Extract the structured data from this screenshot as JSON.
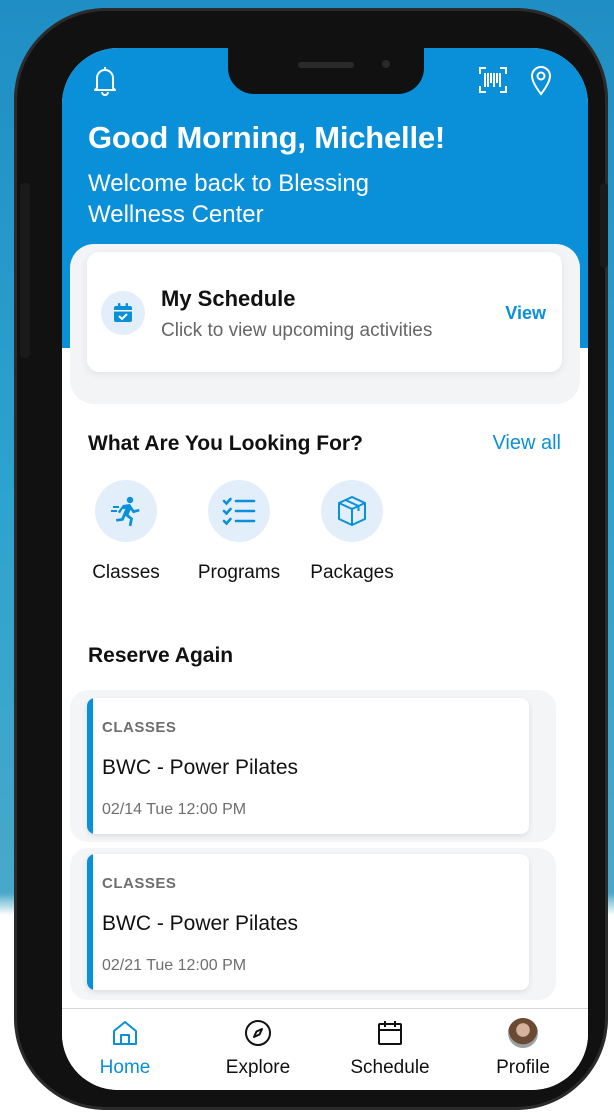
{
  "header": {
    "greeting": "Good Morning, Michelle!",
    "subtitle": "Welcome back to Blessing Wellness Center",
    "icons": [
      "bell-icon",
      "barcode-scan-icon",
      "location-pin-icon"
    ]
  },
  "schedule_card": {
    "title": "My Schedule",
    "subtitle": "Click to view upcoming activities",
    "action": "View",
    "icon": "calendar-check-icon"
  },
  "looking_for": {
    "title": "What Are You Looking For?",
    "view_all": "View all",
    "categories": [
      {
        "label": "Classes",
        "icon": "running-person-icon"
      },
      {
        "label": "Programs",
        "icon": "checklist-icon"
      },
      {
        "label": "Packages",
        "icon": "package-box-icon"
      }
    ]
  },
  "reserve_again": {
    "title": "Reserve Again",
    "items": [
      {
        "tag": "CLASSES",
        "name": "BWC - Power Pilates",
        "date": "02/14 Tue 12:00 PM"
      },
      {
        "tag": "CLASSES",
        "name": "BWC - Power Pilates",
        "date": "02/21 Tue 12:00 PM"
      }
    ]
  },
  "tabbar": {
    "tabs": [
      {
        "label": "Home",
        "icon": "home-icon",
        "active": true
      },
      {
        "label": "Explore",
        "icon": "compass-icon",
        "active": false
      },
      {
        "label": "Schedule",
        "icon": "calendar-icon",
        "active": false
      },
      {
        "label": "Profile",
        "icon": "avatar",
        "active": false
      }
    ]
  },
  "colors": {
    "brand": "#0a8fd9",
    "icon_bg": "#e3eefb"
  }
}
